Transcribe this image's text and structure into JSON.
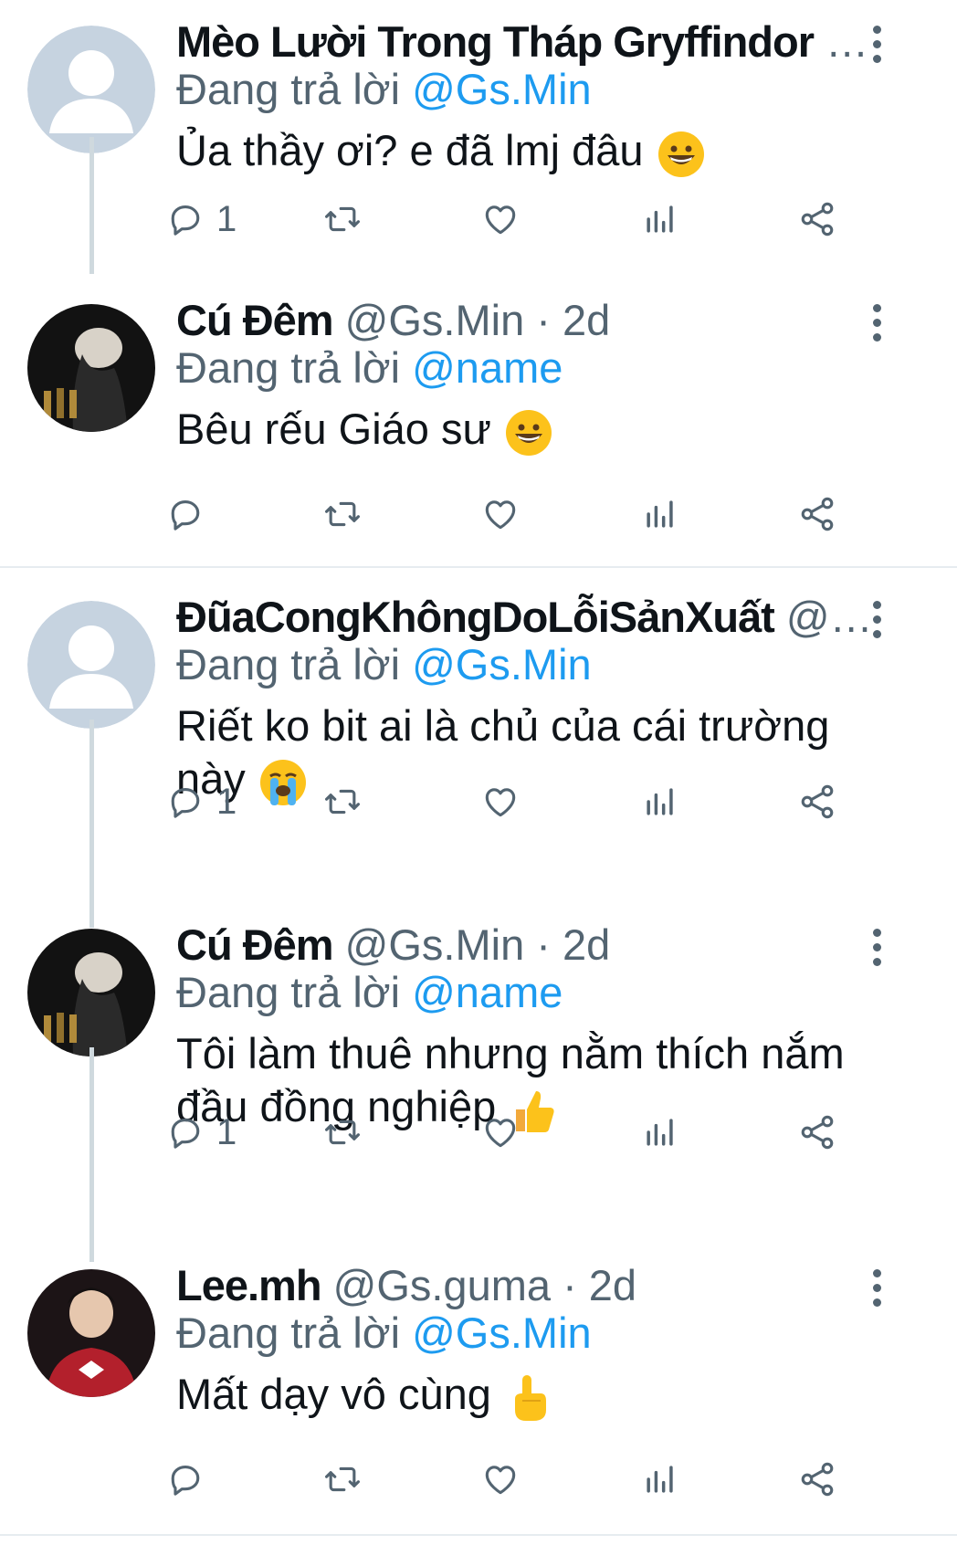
{
  "colors": {
    "link": "#1d9bf0",
    "muted": "#536471",
    "text": "#0f1419",
    "thread_line": "#cfd9de"
  },
  "tweets": [
    {
      "name": "Mèo Lười Trong Tháp Gryffindor",
      "meta": "…",
      "reply_prefix": "Đang trả lời",
      "reply_to": "@Gs.Min",
      "text": "Ủa thầy ơi? e đã lmj đâu",
      "emoji": "grinning-face",
      "reply_count": "1",
      "avatar": "default-avatar"
    },
    {
      "name": "Cú Đêm",
      "meta": "@Gs.Min · 2d",
      "reply_prefix": "Đang trả lời",
      "reply_to": "@name",
      "text": "Bêu rếu Giáo sư",
      "emoji": "grinning-face",
      "reply_count": "",
      "avatar": "photo-avatar-dark"
    },
    {
      "name": "ĐũaCongKhôngDoLỗiSảnXuất",
      "meta": "@…",
      "reply_prefix": "Đang trả lời",
      "reply_to": "@Gs.Min",
      "text": "Riết ko bit ai là chủ của cái trường này",
      "emoji": "loudly-crying-face",
      "reply_count": "1",
      "avatar": "default-avatar"
    },
    {
      "name": "Cú Đêm",
      "meta": "@Gs.Min · 2d",
      "reply_prefix": "Đang trả lời",
      "reply_to": "@name",
      "text": "Tôi làm thuê nhưng nằm thích nắm đầu đồng nghiệp",
      "emoji": "thumbs-up",
      "reply_count": "1",
      "avatar": "photo-avatar-dark"
    },
    {
      "name": "Lee.mh",
      "meta": "@Gs.guma · 2d",
      "reply_prefix": "Đang trả lời",
      "reply_to": "@Gs.Min",
      "text": "Mất dạy vô cùng",
      "emoji": "pointing-up",
      "reply_count": "",
      "avatar": "photo-avatar-jersey"
    }
  ]
}
